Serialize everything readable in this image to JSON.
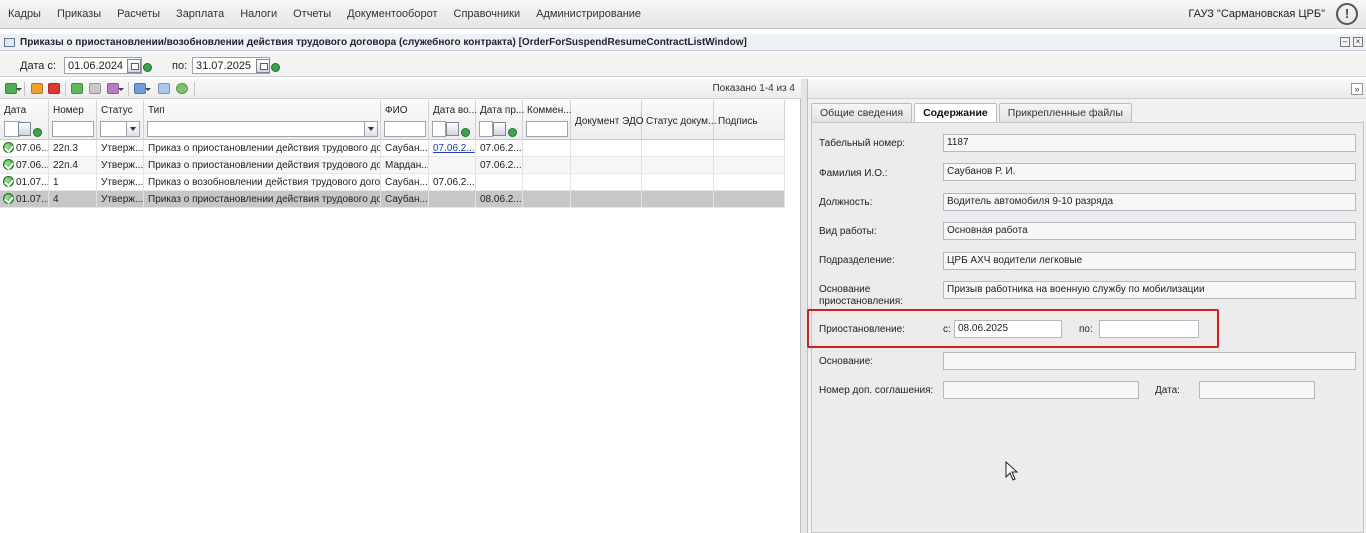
{
  "menu": {
    "items": [
      "Кадры",
      "Приказы",
      "Расчеты",
      "Зарплата",
      "Налоги",
      "Отчеты",
      "Документооборот",
      "Справочники",
      "Администрирование"
    ],
    "org_name": "ГАУЗ \"Сармановская ЦРБ\"",
    "alert_symbol": "!"
  },
  "window": {
    "title": "Приказы о приостановлении/возобновлении действия трудового договора (служебного контракта) [OrderForSuspendResumeContractListWindow]"
  },
  "filter": {
    "date_from_label": "Дата с:",
    "date_from": "01.06.2024",
    "date_to_label": "по:",
    "date_to": "31.07.2025"
  },
  "grid": {
    "shown_text": "Показано 1-4 из 4",
    "columns": [
      "Дата",
      "Номер",
      "Статус",
      "Тип",
      "ФИО",
      "Дата во...",
      "Дата пр...",
      "Коммен...",
      "Документ ЭДО",
      "Статус докум...",
      "Подпись"
    ],
    "rows": [
      {
        "date": "07.06...",
        "number": "22п.3",
        "status": "Утверж...",
        "type": "Приказ о приостановлении действия трудового догов...",
        "fio": "Саубан...",
        "date_vo": "07.06.2...",
        "date_pr": "07.06.2...",
        "comment": ""
      },
      {
        "date": "07.06...",
        "number": "22п.4",
        "status": "Утверж...",
        "type": "Приказ о приостановлении действия трудового догов...",
        "fio": "Мардан...",
        "date_vo": "",
        "date_pr": "07.06.2...",
        "comment": ""
      },
      {
        "date": "01.07...",
        "number": "1",
        "status": "Утверж...",
        "type": "Приказ о возобновлении действия трудового договор...",
        "fio": "Саубан...",
        "date_vo": "07.06.2...",
        "date_pr": "",
        "comment": ""
      },
      {
        "date": "01.07...",
        "number": "4",
        "status": "Утверж...",
        "type": "Приказ о приостановлении действия трудового догов...",
        "fio": "Саубан...",
        "date_vo": "",
        "date_pr": "08.06.2...",
        "comment": ""
      }
    ]
  },
  "details": {
    "tabs": [
      "Общие сведения",
      "Содержание",
      "Прикрепленные файлы"
    ],
    "active_tab": 1,
    "fields": {
      "tab_number_label": "Табельный номер:",
      "tab_number": "1187",
      "fio_label": "Фамилия И.О.:",
      "fio": "Саубанов Р. И.",
      "position_label": "Должность:",
      "position": "Водитель автомобиля 9-10 разряда",
      "work_type_label": "Вид работы:",
      "work_type": "Основная работа",
      "department_label": "Подразделение:",
      "department": "ЦРБ АХЧ водители легковые",
      "reason_label": "Основание приостановления:",
      "reason": "Призыв работника на военную службу по мобилизации",
      "suspension_label": "Приостановление:",
      "from_label": "с:",
      "from_date": "08.06.2025",
      "to_label": "по:",
      "to_date": "",
      "basis_label": "Основание:",
      "basis": "",
      "agreement_label": "Номер доп. соглашения:",
      "agreement": "",
      "date_label": "Дата:",
      "date": ""
    }
  }
}
